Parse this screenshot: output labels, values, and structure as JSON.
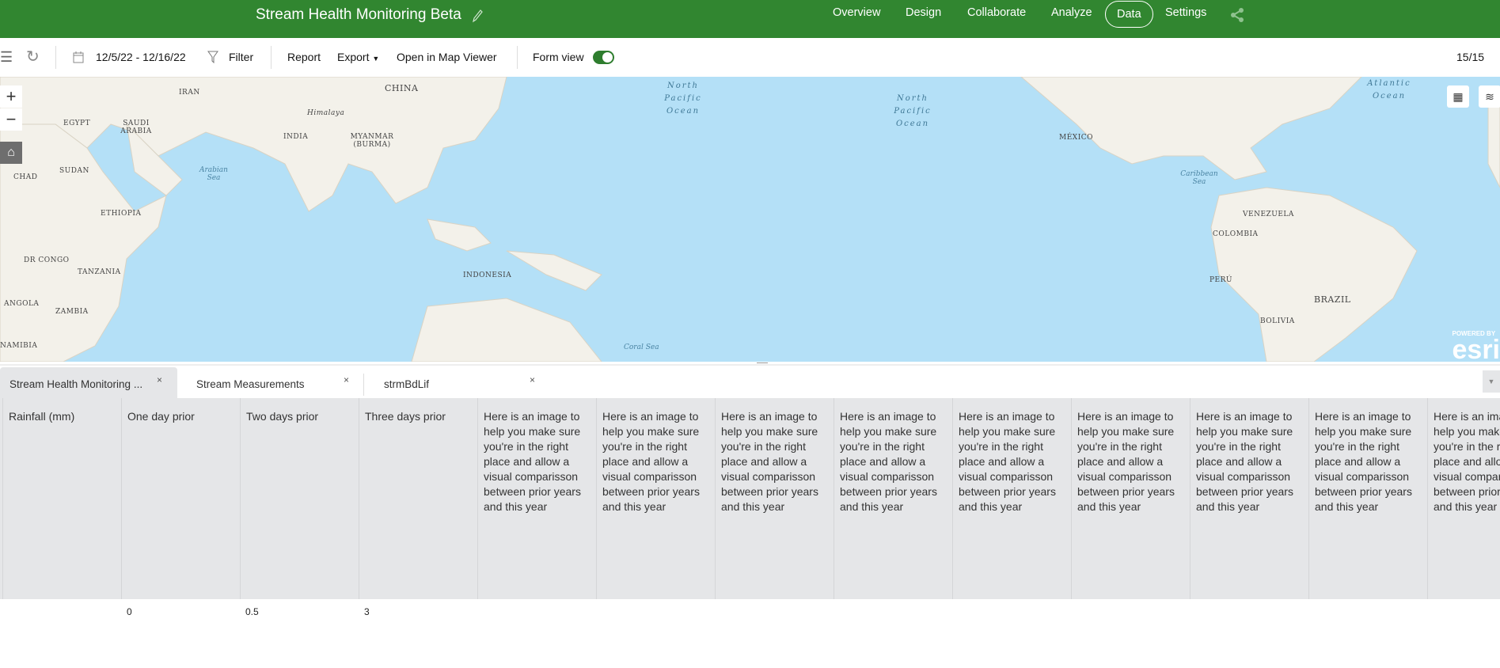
{
  "header": {
    "title": "Stream Health Monitoring Beta",
    "nav": [
      "Overview",
      "Design",
      "Collaborate",
      "Analyze",
      "Data",
      "Settings"
    ],
    "active": "Data",
    "brand_color": "#318630"
  },
  "toolbar": {
    "date_range": "12/5/22 - 12/16/22",
    "filter": "Filter",
    "report": "Report",
    "export": "Export",
    "open_map": "Open in Map Viewer",
    "form_view": "Form view",
    "form_view_on": true,
    "count": "15/15"
  },
  "map": {
    "labels": [
      "IRAN",
      "CHINA",
      "EGYPT",
      "SAUDI ARABIA",
      "Himalaya",
      "INDIA",
      "MYANMAR (BURMA)",
      "MÉXICO",
      "CHAD",
      "SUDAN",
      "ETHIOPIA",
      "VENEZUELA",
      "COLOMBIA",
      "DR CONGO",
      "TANZANIA",
      "INDONESIA",
      "PERÚ",
      "BRAZIL",
      "ANGOLA",
      "ZAMBIA",
      "BOLIVIA",
      "NAMIBIA"
    ],
    "oceans": [
      "North Pacific Ocean",
      "North Pacific Ocean",
      "Atlantic Ocean"
    ],
    "seas": [
      "Arabian Sea",
      "Caribbean Sea",
      "Coral Sea"
    ],
    "attribution": {
      "top": "POWERED BY",
      "logo": "esri"
    }
  },
  "tabs": [
    {
      "label": "Stream Health Monitoring ...",
      "close": "×"
    },
    {
      "label": "Stream Measurements",
      "close": "×"
    },
    {
      "label": "strmBdLif",
      "close": "×"
    }
  ],
  "table": {
    "columns": [
      "Rainfall (mm)",
      "One day prior",
      "Two days prior",
      "Three days prior",
      "Here is an image to help you make sure you're in the right place and allow a visual comparisson between prior years and this year",
      "Here is an image to help you make sure you're in the right place and allow a visual comparisson between prior years and this year",
      "Here is an image to help you make sure you're in the right place and allow a visual comparisson between prior years and this year",
      "Here is an image to help you make sure you're in the right place and allow a visual comparisson between prior years and this year",
      "Here is an image to help you make sure you're in the right place and allow a visual comparisson between prior years and this year",
      "Here is an image to help you make sure you're in the right place and allow a visual comparisson between prior years and this year",
      "Here is an image to help you make sure you're in the right place and allow a visual comparisson between prior years and this year",
      "Here is an image to help you make sure you're in the right place and allow a visual comparisson between prior years and this year",
      "Here is an image to help you make sure you're in the right place and allow a visual comparisson between prior years and this year"
    ],
    "rows": [
      [
        "",
        "0",
        "0.5",
        "3"
      ]
    ]
  }
}
